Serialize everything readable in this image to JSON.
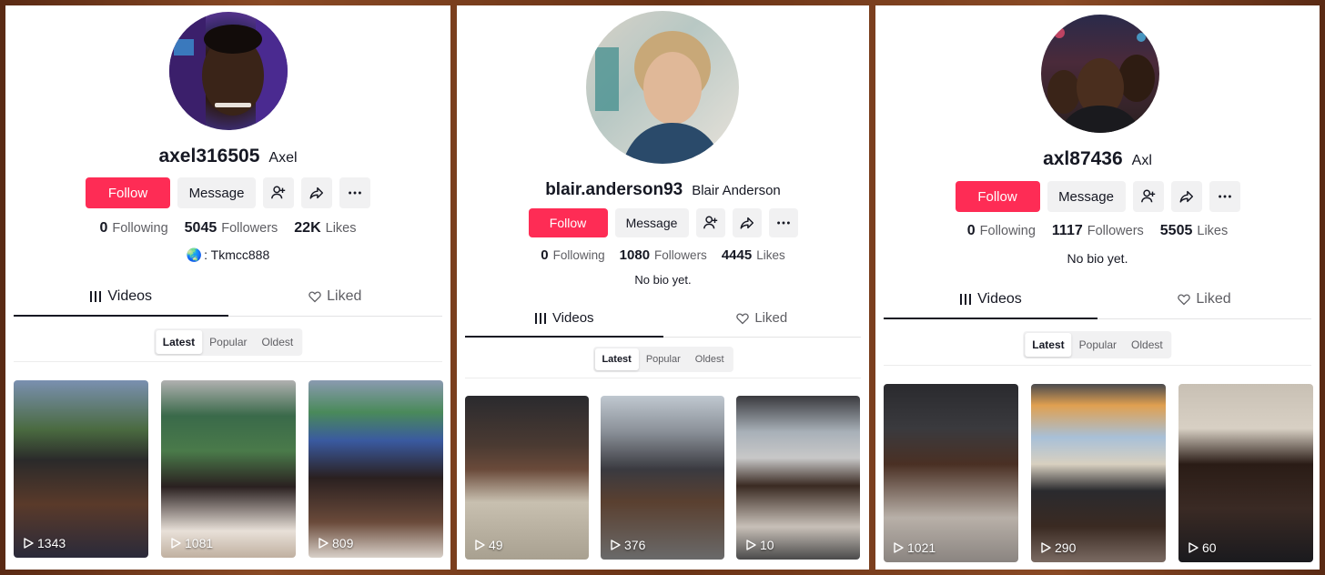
{
  "profiles": [
    {
      "username": "axel316505",
      "nickname": "Axel",
      "follow_label": "Follow",
      "message_label": "Message",
      "following_count": "0",
      "following_label": "Following",
      "followers_count": "5045",
      "followers_label": "Followers",
      "likes_count": "22K",
      "likes_label": "Likes",
      "bio": ":  Tkmcc888",
      "tab_videos": "Videos",
      "tab_liked": "Liked",
      "sort": [
        "Latest",
        "Popular",
        "Oldest"
      ],
      "videos": [
        {
          "views": "1343"
        },
        {
          "views": "1081"
        },
        {
          "views": "809"
        }
      ]
    },
    {
      "username": "blair.anderson93",
      "nickname": "Blair Anderson",
      "follow_label": "Follow",
      "message_label": "Message",
      "following_count": "0",
      "following_label": "Following",
      "followers_count": "1080",
      "followers_label": "Followers",
      "likes_count": "4445",
      "likes_label": "Likes",
      "bio": "No bio yet.",
      "tab_videos": "Videos",
      "tab_liked": "Liked",
      "sort": [
        "Latest",
        "Popular",
        "Oldest"
      ],
      "videos": [
        {
          "views": "49"
        },
        {
          "views": "376"
        },
        {
          "views": "10"
        }
      ]
    },
    {
      "username": "axl87436",
      "nickname": "Axl",
      "follow_label": "Follow",
      "message_label": "Message",
      "following_count": "0",
      "following_label": "Following",
      "followers_count": "1117",
      "followers_label": "Followers",
      "likes_count": "5505",
      "likes_label": "Likes",
      "bio": "No bio yet.",
      "tab_videos": "Videos",
      "tab_liked": "Liked",
      "sort": [
        "Latest",
        "Popular",
        "Oldest"
      ],
      "videos": [
        {
          "views": "1021"
        },
        {
          "views": "290"
        },
        {
          "views": "60"
        }
      ]
    }
  ],
  "colors": {
    "accent": "#fe2c55",
    "text_primary": "#161823",
    "text_secondary": "#5e5e63",
    "button_bg": "#f1f1f2"
  }
}
